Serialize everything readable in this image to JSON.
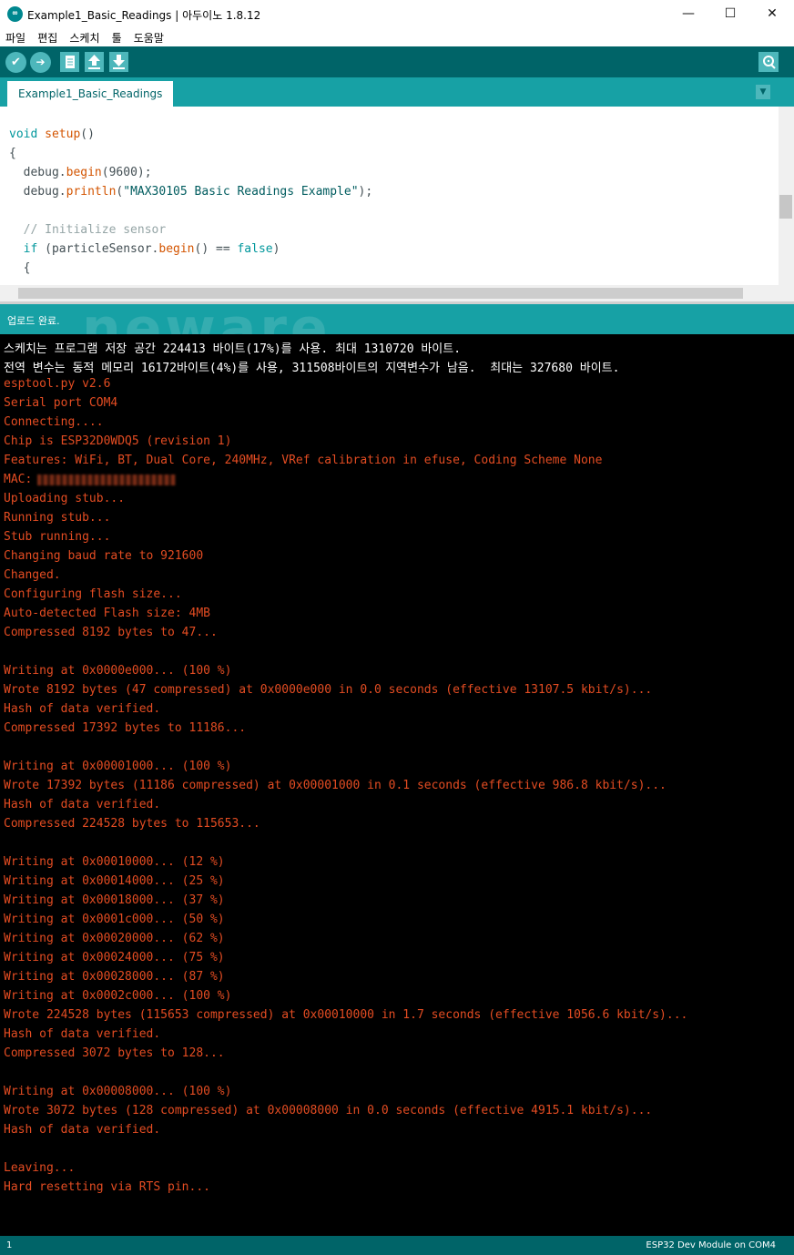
{
  "window": {
    "title": "Example1_Basic_Readings | 아두이노 1.8.12",
    "app_icon": "arduino-logo-icon",
    "app_icon_glyph": "∞",
    "minimize_glyph": "—",
    "maximize_glyph": "☐",
    "close_glyph": "✕"
  },
  "menu": [
    "파일",
    "편집",
    "스케치",
    "툴",
    "도움말"
  ],
  "toolbar": {
    "buttons": [
      "verify-icon",
      "upload-icon",
      "new-icon",
      "open-icon",
      "save-icon"
    ],
    "verify_glyph": "✔",
    "upload_glyph": "➔",
    "serial_monitor": "serial-monitor-icon"
  },
  "tab": {
    "label": "Example1_Basic_Readings",
    "menu_glyph": "▼"
  },
  "code": {
    "l1_kw": "void",
    "l1_fn": "setup",
    "l1_rest": "()",
    "l2": "{",
    "l3_a": "  debug.",
    "l3_fn": "begin",
    "l3_b": "(9600);",
    "l4_a": "  debug.",
    "l4_fn": "println",
    "l4_b": "(",
    "l4_str": "\"MAX30105 Basic Readings Example\"",
    "l4_c": ");",
    "l5_cm": "  // Initialize sensor",
    "l6_kw": "  if",
    "l6_a": " (particleSensor.",
    "l6_fn": "begin",
    "l6_b": "() == ",
    "l6_kw2": "false",
    "l6_c": ")",
    "l7": "  {"
  },
  "status": {
    "message": "업로드 완료."
  },
  "watermark": "neware",
  "console": {
    "sketch_info": "스케치는 프로그램 저장 공간 224413 바이트(17%)를 사용. 최대 1310720 바이트.",
    "mem_info": "전역 변수는 동적 메모리 16172바이트(4%)를 사용, 311508바이트의 지역변수가 남음.  최대는 327680 바이트.",
    "lines_1": [
      "esptool.py v2.6",
      "Serial port COM4",
      "Connecting....",
      "Chip is ESP32D0WDQ5 (revision 1)",
      "Features: WiFi, BT, Dual Core, 240MHz, VRef calibration in efuse, Coding Scheme None"
    ],
    "mac_label": "MAC:",
    "lines_2": [
      "Uploading stub...",
      "Running stub...",
      "Stub running...",
      "Changing baud rate to 921600",
      "Changed.",
      "Configuring flash size...",
      "Auto-detected Flash size: 4MB",
      "Compressed 8192 bytes to 47...",
      "",
      "Writing at 0x0000e000... (100 %)",
      "Wrote 8192 bytes (47 compressed) at 0x0000e000 in 0.0 seconds (effective 13107.5 kbit/s)...",
      "Hash of data verified.",
      "Compressed 17392 bytes to 11186...",
      "",
      "Writing at 0x00001000... (100 %)",
      "Wrote 17392 bytes (11186 compressed) at 0x00001000 in 0.1 seconds (effective 986.8 kbit/s)...",
      "Hash of data verified.",
      "Compressed 224528 bytes to 115653...",
      "",
      "Writing at 0x00010000... (12 %)",
      "Writing at 0x00014000... (25 %)",
      "Writing at 0x00018000... (37 %)",
      "Writing at 0x0001c000... (50 %)",
      "Writing at 0x00020000... (62 %)",
      "Writing at 0x00024000... (75 %)",
      "Writing at 0x00028000... (87 %)",
      "Writing at 0x0002c000... (100 %)",
      "Wrote 224528 bytes (115653 compressed) at 0x00010000 in 1.7 seconds (effective 1056.6 kbit/s)...",
      "Hash of data verified.",
      "Compressed 3072 bytes to 128...",
      "",
      "Writing at 0x00008000... (100 %)",
      "Wrote 3072 bytes (128 compressed) at 0x00008000 in 0.0 seconds (effective 4915.1 kbit/s)...",
      "Hash of data verified.",
      "",
      "Leaving...",
      "Hard resetting via RTS pin..."
    ]
  },
  "footer": {
    "line": "1",
    "board": "ESP32 Dev Module on COM4"
  },
  "colors": {
    "toolbar": "#006468",
    "tabbar": "#17a1a5",
    "console_text": "#e34c22"
  }
}
